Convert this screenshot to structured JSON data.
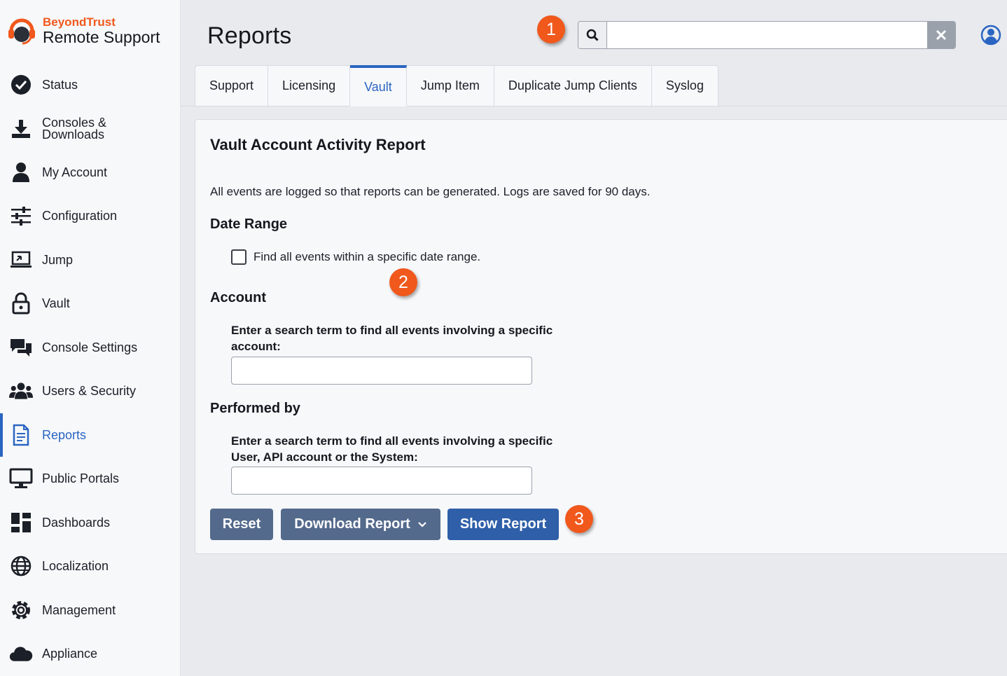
{
  "brand": {
    "top": "BeyondTrust",
    "bottom": "Remote Support",
    "accent_color": "#f0581c"
  },
  "nav": {
    "items": [
      {
        "label": "Status",
        "icon": "check-circle-icon"
      },
      {
        "label": "Consoles &\nDownloads",
        "icon": "download-icon"
      },
      {
        "label": "My Account",
        "icon": "person-icon"
      },
      {
        "label": "Configuration",
        "icon": "sliders-icon"
      },
      {
        "label": "Jump",
        "icon": "jump-icon"
      },
      {
        "label": "Vault",
        "icon": "lock-icon"
      },
      {
        "label": "Console Settings",
        "icon": "chat-icon"
      },
      {
        "label": "Users & Security",
        "icon": "users-icon"
      },
      {
        "label": "Reports",
        "icon": "report-icon",
        "active": true
      },
      {
        "label": "Public Portals",
        "icon": "monitor-icon"
      },
      {
        "label": "Dashboards",
        "icon": "dashboard-icon"
      },
      {
        "label": "Localization",
        "icon": "globe-icon"
      },
      {
        "label": "Management",
        "icon": "gear-icon"
      },
      {
        "label": "Appliance",
        "icon": "cloud-icon"
      }
    ]
  },
  "header": {
    "title": "Reports",
    "search_value": "",
    "search_placeholder": ""
  },
  "badges": [
    "1",
    "2",
    "3"
  ],
  "tabs": [
    {
      "label": "Support"
    },
    {
      "label": "Licensing"
    },
    {
      "label": "Vault",
      "active": true
    },
    {
      "label": "Jump Item"
    },
    {
      "label": "Duplicate Jump Clients"
    },
    {
      "label": "Syslog"
    }
  ],
  "report": {
    "title": "Vault Account Activity Report",
    "description": "All events are logged so that reports can be generated. Logs are saved for 90 days.",
    "date_range": {
      "heading": "Date Range",
      "checkbox_label": "Find all events within a specific date range.",
      "checked": false
    },
    "account": {
      "heading": "Account",
      "field_label": "Enter a search term to find all events involving a specific account:",
      "value": ""
    },
    "performed_by": {
      "heading": "Performed by",
      "field_label": "Enter a search term to find all events involving a specific User, API account or the System:",
      "value": ""
    },
    "buttons": {
      "reset": "Reset",
      "download": "Download Report",
      "show": "Show Report"
    }
  },
  "colors": {
    "active_blue": "#2b65c2",
    "button_gray_blue": "#546a8c",
    "button_primary": "#2f5fa8",
    "badge_orange": "#f0581c"
  }
}
